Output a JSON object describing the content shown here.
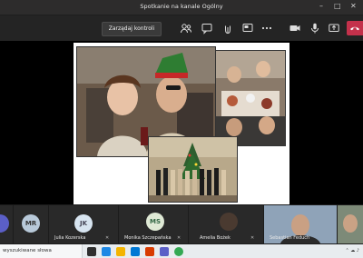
{
  "window": {
    "title": "Spotkanie na kanale Ogólny",
    "controls": [
      "–",
      "□",
      "✕"
    ]
  },
  "toolbar": {
    "timer": "",
    "manage_label": "Zarządaj kontroli",
    "tools": [
      "people-icon",
      "chat-icon",
      "reaction-icon",
      "share-icon",
      "more-icon",
      "camera-icon",
      "mic-icon",
      "share-tray-icon"
    ],
    "leave": "hangup-icon"
  },
  "participants": [
    {
      "initials": "",
      "name": "",
      "color": "#5b5fc7"
    },
    {
      "initials": "MR",
      "name": "",
      "color": "#b8c9d9"
    },
    {
      "initials": "JK",
      "name": "Julia Kozerska",
      "color": "#d7e4f0"
    },
    {
      "initials": "",
      "name": "Monika Szczepańska",
      "color": ""
    },
    {
      "initials": "MS",
      "name": "Monika Szczepańska",
      "color": "#dfe9d5"
    },
    {
      "initials": "",
      "name": "Amelia Bożek",
      "color": ""
    },
    {
      "initials": "",
      "name": "Sebastian Feduch",
      "color": ""
    }
  ],
  "taskbar": {
    "search_placeholder": "wyszukiwane słowa",
    "apps": [
      "task-view-icon",
      "edge-icon",
      "explorer-icon",
      "store-icon",
      "office-icon",
      "teams-icon",
      "chrome-icon"
    ],
    "tray": "⌃ ☁ ♪"
  },
  "colors": {
    "accent": "#6264a7",
    "leave": "#c4314b",
    "teams": "#5b5fc7"
  }
}
